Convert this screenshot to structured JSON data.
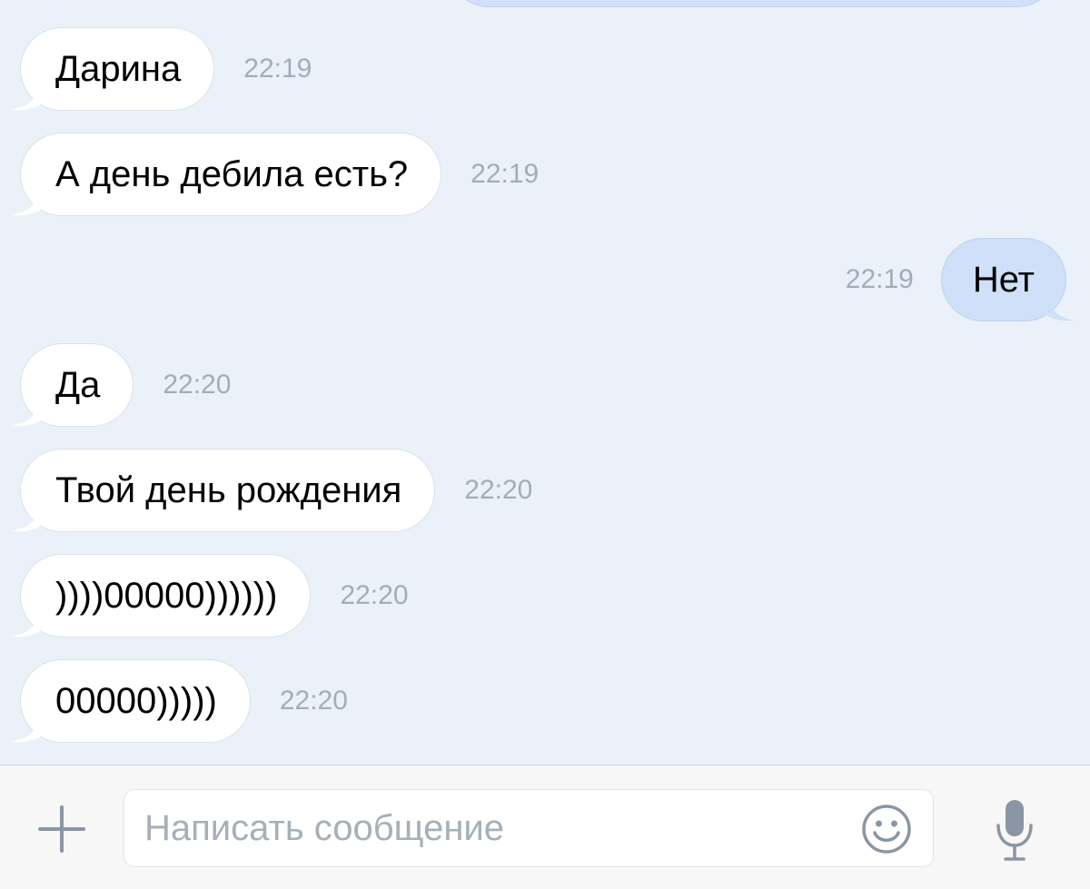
{
  "conversation": {
    "messages": [
      {
        "direction": "in",
        "text": "Дарина",
        "time": "22:19"
      },
      {
        "direction": "in",
        "text": "А день дебила есть?",
        "time": "22:19"
      },
      {
        "direction": "out",
        "text": "Нет",
        "time": "22:19"
      },
      {
        "direction": "in",
        "text": "Да",
        "time": "22:20"
      },
      {
        "direction": "in",
        "text": "Твой день рождения",
        "time": "22:20"
      },
      {
        "direction": "in",
        "text": "))))00000))))))",
        "time": "22:20"
      },
      {
        "direction": "in",
        "text": "00000)))))",
        "time": "22:20"
      }
    ]
  },
  "composer": {
    "placeholder": "Написать сообщение",
    "value": "",
    "icons": {
      "attach": "plus-icon",
      "emoji": "smiley-icon",
      "voice": "microphone-icon"
    }
  },
  "colors": {
    "background": "#ebf1f9",
    "incoming_bubble": "#ffffff",
    "outgoing_bubble": "#cfe0f8",
    "timestamp": "#a3adb8",
    "icon": "#8a96a3",
    "composer_bar": "#f7f7f8"
  }
}
